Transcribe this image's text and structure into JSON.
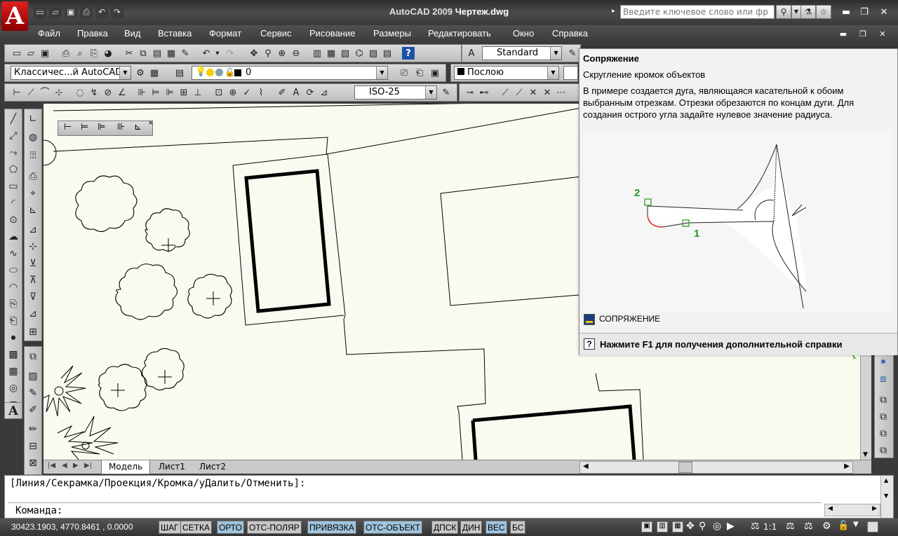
{
  "window": {
    "app_title": "AutoCAD 2009",
    "doc_title": "Чертеж.dwg",
    "search_placeholder": "Введите ключевое слово или фр"
  },
  "menu": [
    "Файл",
    "Правка",
    "Вид",
    "Вставка",
    "Формат",
    "Сервис",
    "Рисование",
    "Размеры",
    "Редактировать",
    "Окно",
    "Справка"
  ],
  "toolbar": {
    "text_style": "Standard",
    "workspace": "Классичес...й AutoCAD",
    "layer": "0",
    "linetype": "Послою",
    "dim_style": "ISO-25"
  },
  "layout_tabs": [
    "Модель",
    "Лист1",
    "Лист2"
  ],
  "command_line": {
    "prompt_line": "[Линия/Секрамка/Проекция/Кромка/уДалить/Отменить]:",
    "input_line": "Команда:"
  },
  "status": {
    "coords": "30423.1903, 4770.8461 , 0.0000",
    "buttons": [
      {
        "label": "ШАГ",
        "on": false
      },
      {
        "label": "СЕТКА",
        "on": false
      },
      {
        "label": "ОРТО",
        "on": true
      },
      {
        "label": "ОТС-ПОЛЯР",
        "on": false
      },
      {
        "label": "ПРИВЯЗКА",
        "on": true
      },
      {
        "label": "ОТС-ОБЪЕКТ",
        "on": true
      },
      {
        "label": "ДПСК",
        "on": false
      },
      {
        "label": "ДИН",
        "on": false
      },
      {
        "label": "ВЕС",
        "on": true
      },
      {
        "label": "БС",
        "on": false
      }
    ],
    "scale": "1:1"
  },
  "tooltip": {
    "title": "Сопряжение",
    "subtitle": "Скругление кромок объектов",
    "description": "В примере создается дуга, являющаяся касательной к обоим выбранным отрезкам. Отрезки обрезаются по концам дуги. Для создания острого угла задайте нулевое значение радиуса.",
    "label_2": "2",
    "label_1": "1",
    "command_name": "СОПРЯЖЕНИЕ",
    "help": "Нажмите F1 для получения дополнительной справки"
  },
  "colors": {
    "accent": "#1e9b1e",
    "arc": "#e02020",
    "canvas": "#fbfaf0",
    "status_on": "#9fc3dd"
  }
}
